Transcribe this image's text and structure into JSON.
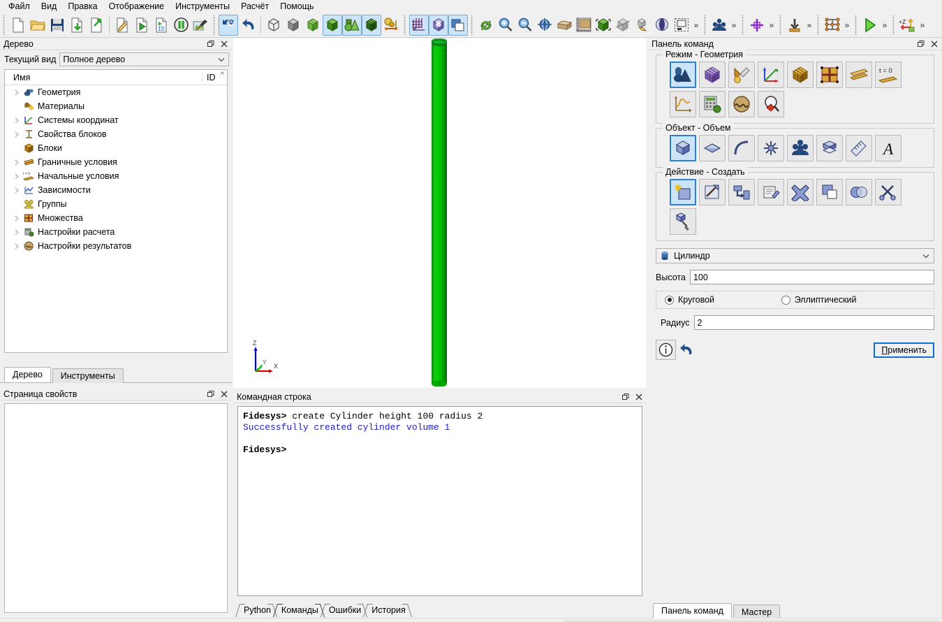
{
  "app": {
    "title": "Fidesys",
    "accent": "#2d7fd0",
    "geometry_color": "#00c000"
  },
  "menubar": {
    "items": [
      {
        "label": "Файл",
        "name": "menu-file"
      },
      {
        "label": "Вид",
        "name": "menu-view"
      },
      {
        "label": "Правка",
        "name": "menu-edit"
      },
      {
        "label": "Отображение",
        "name": "menu-display"
      },
      {
        "label": "Инструменты",
        "name": "menu-tools"
      },
      {
        "label": "Расчёт",
        "name": "menu-analysis"
      },
      {
        "label": "Помощь",
        "name": "menu-help"
      }
    ]
  },
  "toolbar": {
    "groups": [
      {
        "name": "file-toolbar",
        "buttons": [
          {
            "icon": "new-file-icon",
            "selected": false
          },
          {
            "icon": "open-folder-icon",
            "selected": false
          },
          {
            "icon": "save-icon",
            "selected": false
          },
          {
            "icon": "import-icon",
            "selected": false
          },
          {
            "icon": "export-icon",
            "selected": false
          },
          {
            "icon": "edit-journal-icon",
            "selected": false
          },
          {
            "icon": "play-journal-icon",
            "selected": false
          },
          {
            "icon": "journal-id-icon",
            "selected": false
          },
          {
            "icon": "pause-icon",
            "selected": false
          },
          {
            "icon": "build-icon",
            "selected": false
          }
        ]
      },
      {
        "name": "undo-toolbar",
        "buttons": [
          {
            "icon": "reset-icon",
            "selected": true
          },
          {
            "icon": "undo-icon",
            "selected": false
          }
        ]
      },
      {
        "name": "display-mode-toolbar",
        "buttons": [
          {
            "icon": "wireframe-cube-icon",
            "selected": false
          },
          {
            "icon": "hidden-line-cube-icon",
            "selected": false
          },
          {
            "icon": "smooth-shade-cube-icon",
            "selected": false
          },
          {
            "icon": "solid-cube-icon",
            "selected": true
          },
          {
            "icon": "geometry-primitives-icon",
            "selected": true
          },
          {
            "icon": "mesh-cube-icon",
            "selected": true
          },
          {
            "icon": "composite-icon",
            "selected": false
          }
        ]
      },
      {
        "name": "grid-toolbar",
        "buttons": [
          {
            "icon": "grid-icon",
            "selected": true
          },
          {
            "icon": "transparency-cube-icon",
            "selected": true
          },
          {
            "icon": "layers-icon",
            "selected": true
          }
        ]
      },
      {
        "name": "view-toolbar",
        "buttons": [
          {
            "icon": "refresh-icon",
            "selected": false
          },
          {
            "icon": "zoom-in-icon",
            "selected": false
          },
          {
            "icon": "zoom-out-icon",
            "selected": false
          },
          {
            "icon": "rotate-view-icon",
            "selected": false
          },
          {
            "icon": "perspective-box-icon",
            "selected": false
          },
          {
            "icon": "measure-icon",
            "selected": false
          },
          {
            "icon": "fit-view-icon",
            "selected": false
          },
          {
            "icon": "clip-plane-icon",
            "selected": false
          },
          {
            "icon": "copy-view-icon",
            "selected": false
          },
          {
            "icon": "contrast-icon",
            "selected": false
          },
          {
            "icon": "snapshot-icon",
            "selected": false
          }
        ]
      },
      {
        "name": "entity-toolbar",
        "buttons": [
          {
            "icon": "group-entities-icon",
            "selected": false
          }
        ]
      },
      {
        "name": "coordinate-toolbar",
        "buttons": [
          {
            "icon": "add-crosshair-icon",
            "selected": false
          }
        ]
      },
      {
        "name": "load-toolbar",
        "buttons": [
          {
            "icon": "apply-load-icon",
            "selected": false
          }
        ]
      },
      {
        "name": "mesh-toolbar",
        "buttons": [
          {
            "icon": "mesh-nodes-icon",
            "selected": false
          }
        ]
      },
      {
        "name": "solve-toolbar",
        "buttons": [
          {
            "icon": "run-solver-icon",
            "selected": false
          }
        ]
      },
      {
        "name": "orientation-toolbar",
        "buttons": [
          {
            "icon": "axis-z-orientation-icon",
            "selected": false
          }
        ]
      }
    ],
    "overflow_label": "»"
  },
  "tree_panel": {
    "title": "Дерево",
    "view_label": "Текущий вид",
    "view_value": "Полное дерево",
    "columns": {
      "name": "Имя",
      "id": "ID"
    },
    "items": [
      {
        "label": "Геометрия",
        "icon": "geometry-icon",
        "expandable": true
      },
      {
        "label": "Материалы",
        "icon": "materials-icon",
        "expandable": false
      },
      {
        "label": "Системы координат",
        "icon": "coordinate-systems-icon",
        "expandable": true
      },
      {
        "label": "Свойства блоков",
        "icon": "block-properties-icon",
        "expandable": true
      },
      {
        "label": "Блоки",
        "icon": "blocks-icon",
        "expandable": false
      },
      {
        "label": "Граничные условия",
        "icon": "boundary-conditions-icon",
        "expandable": true
      },
      {
        "label": "Начальные условия",
        "icon": "initial-conditions-icon",
        "expandable": true
      },
      {
        "label": "Зависимости",
        "icon": "dependencies-icon",
        "expandable": true
      },
      {
        "label": "Группы",
        "icon": "groups-icon",
        "expandable": false
      },
      {
        "label": "Множества",
        "icon": "sets-icon",
        "expandable": true
      },
      {
        "label": "Настройки расчета",
        "icon": "analysis-settings-icon",
        "expandable": true
      },
      {
        "label": "Настройки результатов",
        "icon": "results-settings-icon",
        "expandable": true
      }
    ],
    "tabs": [
      {
        "label": "Дерево",
        "active": true
      },
      {
        "label": "Инструменты",
        "active": false
      }
    ]
  },
  "properties_panel": {
    "title": "Страница свойств"
  },
  "viewport": {
    "name": "3d-viewport",
    "axis_labels": {
      "x": "X",
      "y": "Y",
      "z": "Z"
    },
    "axis_colors": {
      "x": "#e00000",
      "y": "#00c000",
      "z": "#0000e0"
    },
    "model": "cylinder"
  },
  "console_panel": {
    "title": "Командная строка",
    "lines": [
      {
        "prompt": "Fidesys>",
        "text": " create Cylinder height 100 radius 2",
        "type": "command"
      },
      {
        "prompt": "",
        "text": "Successfully created cylinder volume 1",
        "type": "success"
      },
      {
        "prompt": "",
        "text": "",
        "type": "blank"
      },
      {
        "prompt": "Fidesys>",
        "text": "",
        "type": "command"
      }
    ],
    "tabs": [
      {
        "label": "Python",
        "active": false
      },
      {
        "label": "Команды",
        "active": true
      },
      {
        "label": "Ошибки",
        "active": false
      },
      {
        "label": "История",
        "active": false
      }
    ]
  },
  "command_panel": {
    "title": "Панель команд",
    "groups": [
      {
        "title": "Режим - Геометрия",
        "name": "mode-group",
        "buttons": [
          {
            "icon": "geometry-mode-icon",
            "selected": true
          },
          {
            "icon": "mesh-mode-icon",
            "selected": false
          },
          {
            "icon": "material-mode-icon",
            "selected": false
          },
          {
            "icon": "coordinate-system-mode-icon",
            "selected": false
          },
          {
            "icon": "blocks-mode-icon",
            "selected": false
          },
          {
            "icon": "sets-mode-icon",
            "selected": false
          },
          {
            "icon": "boundary-conditions-mode-icon",
            "selected": false
          },
          {
            "icon": "initial-conditions-mode-icon",
            "selected": false
          },
          {
            "icon": "dependencies-mode-icon",
            "selected": false
          },
          {
            "icon": "analysis-settings-mode-icon",
            "selected": false
          },
          {
            "icon": "results-mode-icon",
            "selected": false
          },
          {
            "icon": "inspect-mode-icon",
            "selected": false
          }
        ]
      },
      {
        "title": "Объект - Объем",
        "name": "object-group",
        "buttons": [
          {
            "icon": "volume-icon",
            "selected": true
          },
          {
            "icon": "surface-icon",
            "selected": false
          },
          {
            "icon": "curve-icon",
            "selected": false
          },
          {
            "icon": "vertex-icon",
            "selected": false
          },
          {
            "icon": "group-icon",
            "selected": false
          },
          {
            "icon": "sheet-body-icon",
            "selected": false
          },
          {
            "icon": "ruler-icon",
            "selected": false
          },
          {
            "icon": "text-icon",
            "selected": false
          }
        ]
      },
      {
        "title": "Действие - Создать",
        "name": "action-group",
        "buttons": [
          {
            "icon": "create-icon",
            "selected": true
          },
          {
            "icon": "sweep-icon",
            "selected": false
          },
          {
            "icon": "move-copy-icon",
            "selected": false
          },
          {
            "icon": "modify-icon",
            "selected": false
          },
          {
            "icon": "delete-icon",
            "selected": false
          },
          {
            "icon": "copy-icon",
            "selected": false
          },
          {
            "icon": "boolean-icon",
            "selected": false
          },
          {
            "icon": "webcut-icon",
            "selected": false
          },
          {
            "icon": "cleanup-icon",
            "selected": false
          }
        ]
      }
    ],
    "shape_select": {
      "value": "Цилиндр",
      "icon": "cylinder-icon"
    },
    "fields": [
      {
        "label": "Высота",
        "value": "100",
        "name": "height-field"
      },
      {
        "label": "Радиус",
        "value": "2",
        "name": "radius-field"
      }
    ],
    "radios": [
      {
        "label": "Круговой",
        "selected": true
      },
      {
        "label": "Эллиптический",
        "selected": false
      }
    ],
    "info_button": "info-icon",
    "reset_button": "reset-icon",
    "apply_button": {
      "prefix": "П",
      "rest": "рименить"
    },
    "tabs": [
      {
        "label": "Панель команд",
        "active": true
      },
      {
        "label": "Мастер",
        "active": false
      }
    ]
  }
}
